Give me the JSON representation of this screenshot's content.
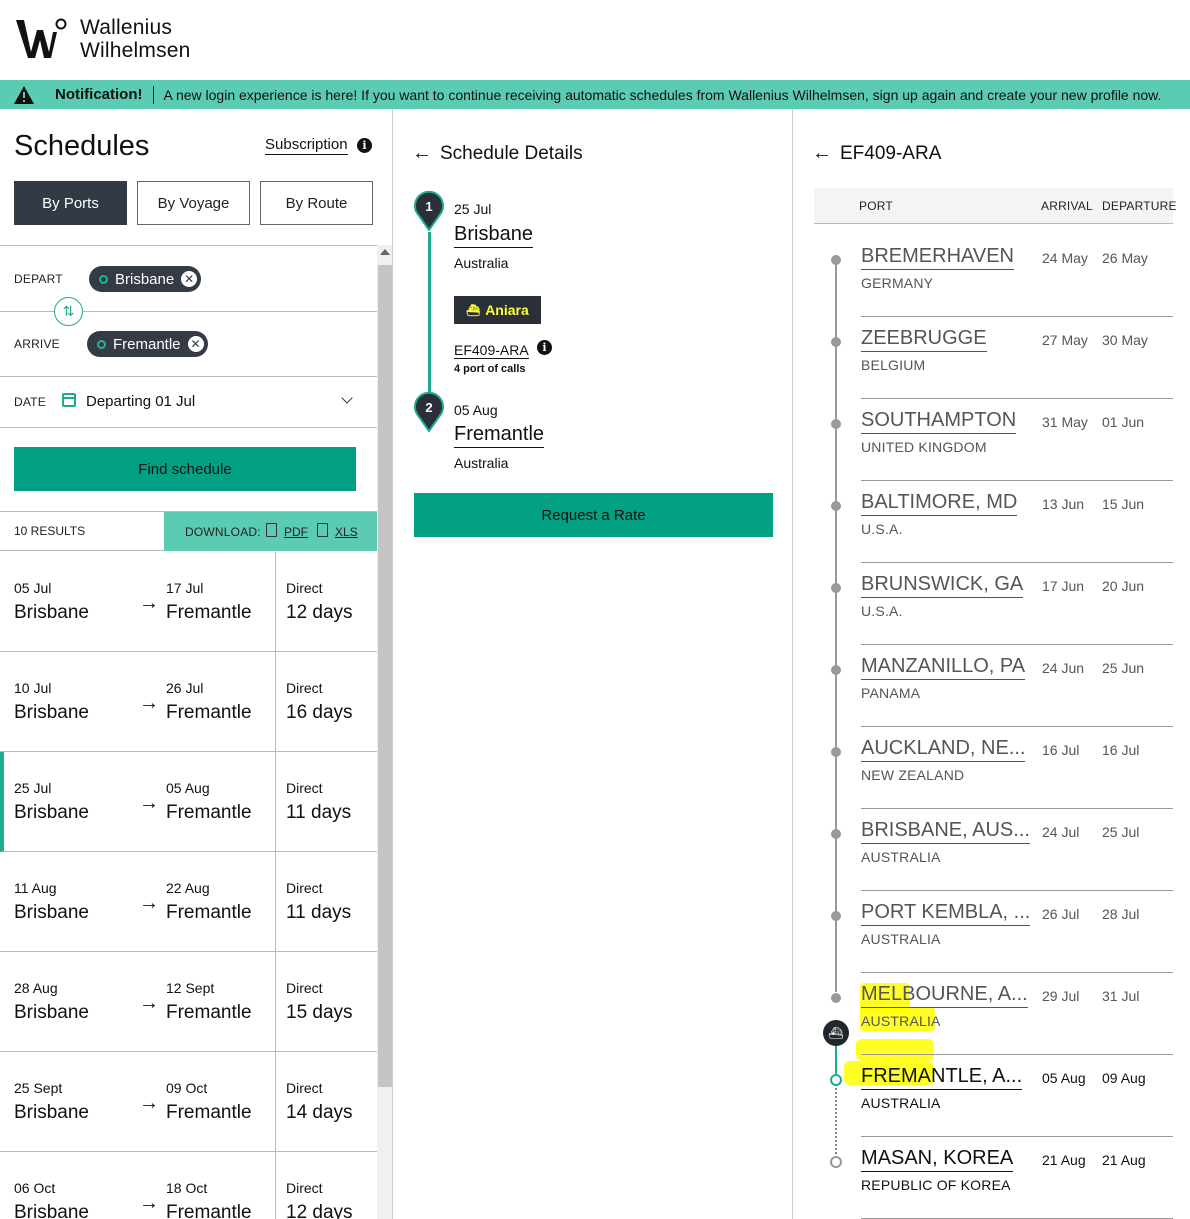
{
  "brand": {
    "line1": "Wallenius",
    "line2": "Wilhelmsen"
  },
  "notification": {
    "title": "Notification!",
    "message": "A new login experience is here! If you want to continue receiving automatic schedules from Wallenius Wilhelmsen, sign up again and create your new profile now."
  },
  "left": {
    "title": "Schedules",
    "subscription": "Subscription",
    "info": "i",
    "tabs": [
      {
        "label": "By Ports",
        "active": true
      },
      {
        "label": "By Voyage",
        "active": false
      },
      {
        "label": "By Route",
        "active": false
      }
    ],
    "depart_label": "DEPART",
    "depart_value": "Brisbane",
    "arrive_label": "ARRIVE",
    "arrive_value": "Fremantle",
    "date_label": "DATE",
    "date_value": "Departing 01 Jul",
    "find_button": "Find schedule",
    "results_count": "10 RESULTS",
    "download_label": "DOWNLOAD:",
    "pdf": "PDF",
    "xls": "XLS",
    "results": [
      {
        "dep_date": "05 Jul",
        "from": "Brisbane",
        "arr_date": "17 Jul",
        "to": "Fremantle",
        "type": "Direct",
        "duration": "12 days",
        "selected": false
      },
      {
        "dep_date": "10 Jul",
        "from": "Brisbane",
        "arr_date": "26 Jul",
        "to": "Fremantle",
        "type": "Direct",
        "duration": "16 days",
        "selected": false
      },
      {
        "dep_date": "25 Jul",
        "from": "Brisbane",
        "arr_date": "05 Aug",
        "to": "Fremantle",
        "type": "Direct",
        "duration": "11 days",
        "selected": true
      },
      {
        "dep_date": "11 Aug",
        "from": "Brisbane",
        "arr_date": "22 Aug",
        "to": "Fremantle",
        "type": "Direct",
        "duration": "11 days",
        "selected": false
      },
      {
        "dep_date": "28 Aug",
        "from": "Brisbane",
        "arr_date": "12 Sept",
        "to": "Fremantle",
        "type": "Direct",
        "duration": "15 days",
        "selected": false
      },
      {
        "dep_date": "25 Sept",
        "from": "Brisbane",
        "arr_date": "09 Oct",
        "to": "Fremantle",
        "type": "Direct",
        "duration": "14 days",
        "selected": false
      },
      {
        "dep_date": "06 Oct",
        "from": "Brisbane",
        "arr_date": "18 Oct",
        "to": "Fremantle",
        "type": "Direct",
        "duration": "12 days",
        "selected": false
      }
    ]
  },
  "middle": {
    "title": "Schedule Details",
    "stops": [
      {
        "num": "1",
        "date": "25 Jul",
        "port": "Brisbane",
        "country": "Australia"
      },
      {
        "num": "2",
        "date": "05 Aug",
        "port": "Fremantle",
        "country": "Australia"
      }
    ],
    "vessel": "Aniara",
    "voyage": "EF409-ARA",
    "calls": "4 port of calls",
    "request_button": "Request a Rate"
  },
  "right": {
    "title": "EF409-ARA",
    "col_port": "PORT",
    "col_arrival": "ARRIVAL",
    "col_departure": "DEPARTURE",
    "ports": [
      {
        "name": "BREMERHAVEN",
        "country": "GERMANY",
        "arrival": "24 May",
        "departure": "26 May"
      },
      {
        "name": "ZEEBRUGGE",
        "country": "BELGIUM",
        "arrival": "27 May",
        "departure": "30 May"
      },
      {
        "name": "SOUTHAMPTON",
        "country": "UNITED KINGDOM",
        "arrival": "31 May",
        "departure": "01 Jun"
      },
      {
        "name": "BALTIMORE, MD",
        "country": "U.S.A.",
        "arrival": "13 Jun",
        "departure": "15 Jun"
      },
      {
        "name": "BRUNSWICK, GA",
        "country": "U.S.A.",
        "arrival": "17 Jun",
        "departure": "20 Jun"
      },
      {
        "name": "MANZANILLO, PA",
        "country": "PANAMA",
        "arrival": "24 Jun",
        "departure": "25 Jun"
      },
      {
        "name": "AUCKLAND, NE...",
        "country": "NEW ZEALAND",
        "arrival": "16 Jul",
        "departure": "16 Jul"
      },
      {
        "name": "BRISBANE, AUS...",
        "country": "AUSTRALIA",
        "arrival": "24 Jul",
        "departure": "25 Jul"
      },
      {
        "name": "PORT KEMBLA, ...",
        "country": "AUSTRALIA",
        "arrival": "26 Jul",
        "departure": "28 Jul"
      },
      {
        "name": "MELBOURNE, A...",
        "country": "AUSTRALIA",
        "arrival": "29 Jul",
        "departure": "31 Jul"
      },
      {
        "name": "FREMANTLE, A...",
        "country": "AUSTRALIA",
        "arrival": "05 Aug",
        "departure": "09 Aug"
      },
      {
        "name": "MASAN, KOREA",
        "country": "REPUBLIC OF KOREA",
        "arrival": "21 Aug",
        "departure": "21 Aug"
      }
    ]
  },
  "colors": {
    "accent": "#03a184",
    "notification": "#5ccbb4",
    "dark": "#323a46",
    "highlight": "#ffff00"
  },
  "icons": [
    "warning-icon",
    "info-icon",
    "swap-icon",
    "calendar-icon",
    "chevron-down-icon",
    "file-icon",
    "arrow-left-icon",
    "arrow-right-icon",
    "location-pin-icon",
    "ship-icon",
    "close-icon"
  ]
}
